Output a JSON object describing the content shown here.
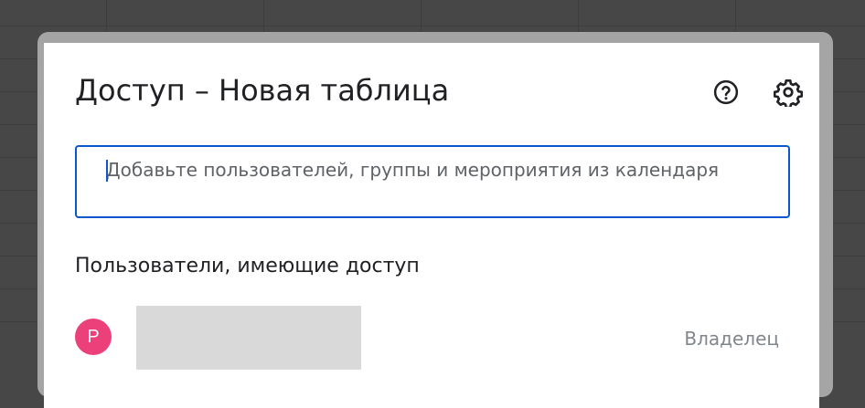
{
  "dialog": {
    "title": "Доступ – Новая таблица",
    "help_icon": "help-circle-icon",
    "settings_icon": "gear-icon"
  },
  "share_input": {
    "placeholder": "Добавьте пользователей, группы и мероприятия из календаря",
    "value": ""
  },
  "people_section": {
    "heading": "Пользователи, имеющие доступ",
    "users": [
      {
        "avatar_initial": "P",
        "avatar_color": "#ec407a",
        "role": "Владелец"
      }
    ]
  },
  "colors": {
    "accent": "#0b57d0",
    "background": "#474747"
  }
}
